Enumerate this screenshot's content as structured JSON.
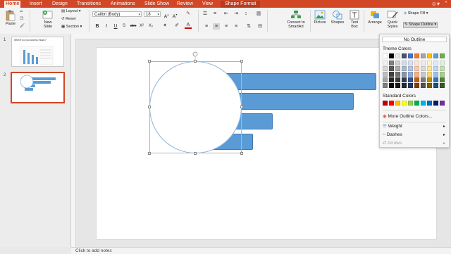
{
  "tabs": [
    {
      "label": "Home",
      "active": true
    },
    {
      "label": "Insert"
    },
    {
      "label": "Design"
    },
    {
      "label": "Transitions"
    },
    {
      "label": "Animations"
    },
    {
      "label": "Slide Show"
    },
    {
      "label": "Review"
    },
    {
      "label": "View"
    },
    {
      "label": "Shape Format",
      "contextual": true
    }
  ],
  "ribbon": {
    "paste": "Paste",
    "new_slide": "New Slide",
    "layout": "Layout",
    "reset": "Reset",
    "section": "Section",
    "font_name": "Calibri (Body)",
    "font_size": "18",
    "convert_smartart": "Convert to SmartArt",
    "picture": "Picture",
    "shapes": "Shapes",
    "text_box": "Text Box",
    "arrange": "Arrange",
    "quick_styles": "Quick Styles",
    "shape_fill": "Shape Fill",
    "shape_outline": "Shape Outline"
  },
  "thumbnails": {
    "slide1_num": "1",
    "slide1_title": "Where do you access music?",
    "slide2_num": "2"
  },
  "outline_menu": {
    "no_outline": "No Outline",
    "theme_colors_label": "Theme Colors",
    "standard_colors_label": "Standard Colors",
    "more_colors": "More Outline Colors...",
    "weight": "Weight",
    "dashes": "Dashes",
    "arrows": "Arrows",
    "theme_top_row": [
      "#ffffff",
      "#000000",
      "#e7e6e6",
      "#44546a",
      "#4472c4",
      "#ed7d31",
      "#a5a5a5",
      "#ffc000",
      "#5b9bd5",
      "#70ad47"
    ],
    "theme_shades": [
      [
        "#f2f2f2",
        "#7f7f7f",
        "#d0cece",
        "#d6dce4",
        "#d9e2f3",
        "#fbe5d5",
        "#ededed",
        "#fff2cc",
        "#deebf6",
        "#e2efd9"
      ],
      [
        "#d8d8d8",
        "#595959",
        "#aeabab",
        "#adb9ca",
        "#b4c6e7",
        "#f7cbac",
        "#dbdbdb",
        "#fee599",
        "#bdd7ee",
        "#c5e0b3"
      ],
      [
        "#bfbfbf",
        "#3f3f3f",
        "#757070",
        "#8496b0",
        "#8eaadb",
        "#f4b183",
        "#c9c9c9",
        "#ffd965",
        "#9cc3e5",
        "#a8d08d"
      ],
      [
        "#a5a5a5",
        "#262626",
        "#3a3838",
        "#323f4f",
        "#2f5496",
        "#c55a11",
        "#7b7b7b",
        "#bf9000",
        "#2e75b5",
        "#538135"
      ],
      [
        "#7f7f7f",
        "#0c0c0c",
        "#171616",
        "#222a35",
        "#1f3864",
        "#843c0b",
        "#525252",
        "#7f6000",
        "#1f4e79",
        "#375623"
      ]
    ],
    "standard": [
      "#c00000",
      "#ff0000",
      "#ffc000",
      "#ffff00",
      "#92d050",
      "#00b050",
      "#00b0f0",
      "#0070c0",
      "#002060",
      "#7030a0"
    ]
  },
  "notes_placeholder": "Click to add notes",
  "colors": {
    "accent": "#d24726",
    "bar_blue": "#5b9bd5"
  }
}
